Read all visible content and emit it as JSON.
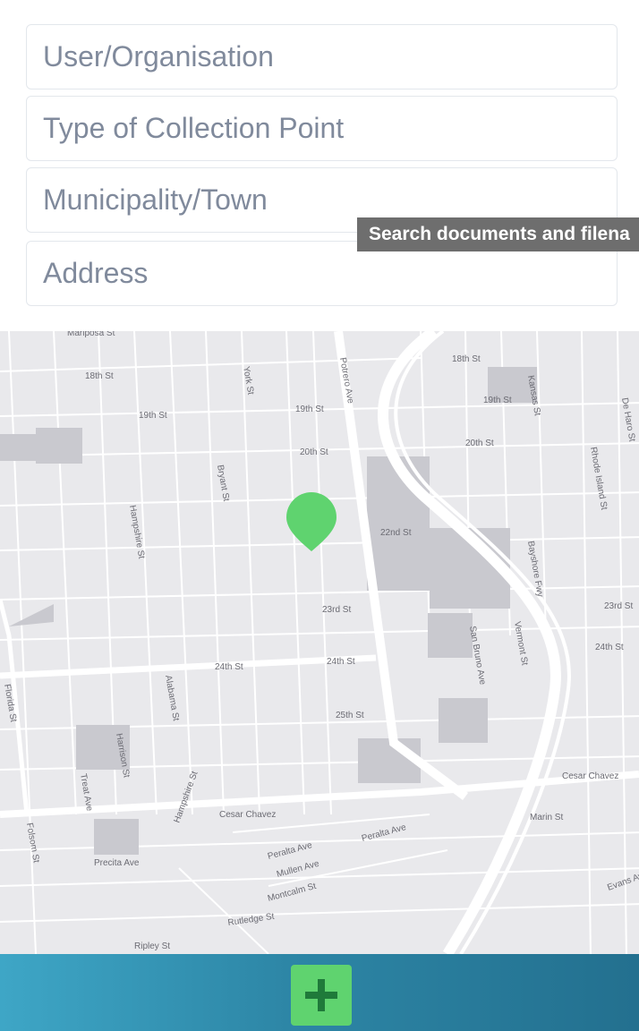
{
  "form": {
    "user_placeholder": "User/Organisation",
    "type_placeholder": "Type of Collection Point",
    "municipality_placeholder": "Municipality/Town",
    "address_placeholder": "Address"
  },
  "tooltip": {
    "text": "Search documents and filena"
  },
  "map": {
    "streets": [
      "Mariposa St",
      "18th St",
      "18th St",
      "19th St",
      "19th St",
      "19th St",
      "20th St",
      "20th St",
      "22nd St",
      "23rd St",
      "23rd St",
      "24th St",
      "24th St",
      "24th St",
      "25th St",
      "Cesar Chavez",
      "Cesar Chavez",
      "Precita Ave",
      "Peralta Ave",
      "Peralta Ave",
      "Mullen Ave",
      "Montcalm St",
      "Rutledge St",
      "Ripley St",
      "Potrero Ave",
      "York St",
      "Bryant St",
      "Florida St",
      "Alabama St",
      "Harrison St",
      "Treat Ave",
      "Folsom St",
      "Hampshire St",
      "San Bruno Ave",
      "Vermont St",
      "Kansas St",
      "Rhode Island St",
      "De Haro St",
      "Marin St",
      "Evans Ave",
      "Bayshore Fwy",
      "Hampshire St"
    ],
    "marker_color": "#5fd36f"
  },
  "bottombar": {
    "add_icon": "plus-icon",
    "button_color": "#5fd36f"
  }
}
